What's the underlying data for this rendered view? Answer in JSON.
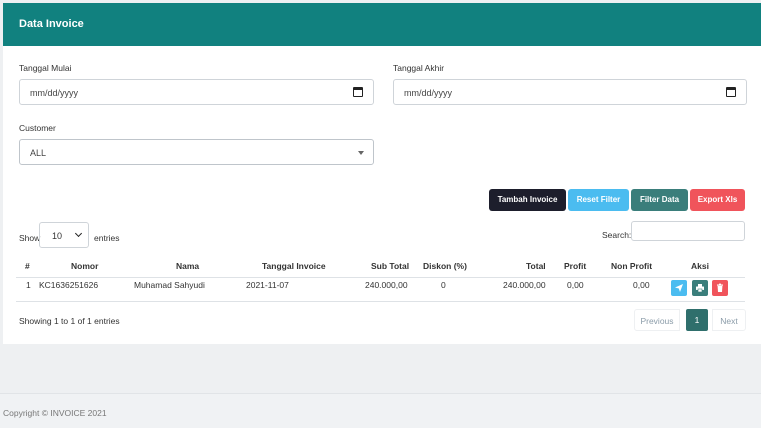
{
  "header": {
    "title": "Data Invoice"
  },
  "filters": {
    "start_label": "Tanggal Mulai",
    "start_placeholder": "mm/dd/yyyy",
    "end_label": "Tanggal Akhir",
    "end_placeholder": "mm/dd/yyyy",
    "customer_label": "Customer",
    "customer_value": "ALL"
  },
  "actions": {
    "tambah": "Tambah Invoice",
    "reset": "Reset Filter",
    "filter": "Filter Data",
    "export": "Export Xls"
  },
  "table_controls": {
    "show_label": "Show",
    "entries_value": "10",
    "entries_label": "entries",
    "search_label": "Search:"
  },
  "table": {
    "headers": [
      "#",
      "Nomor",
      "Nama",
      "Tanggal Invoice",
      "Sub Total",
      "Diskon (%)",
      "Total",
      "Profit",
      "Non Profit",
      "Aksi"
    ],
    "rows": [
      [
        "1",
        "KC1636251626",
        "Muhamad Sahyudi",
        "2021-11-07",
        "240.000,00",
        "0",
        "240.000,00",
        "0,00",
        "0,00"
      ]
    ],
    "row_actions": [
      "send-icon",
      "print-icon",
      "trash-icon"
    ]
  },
  "pagination": {
    "info": "Showing 1 to 1 of 1 entries",
    "previous": "Previous",
    "current": "1",
    "next": "Next"
  },
  "footer": {
    "copyright": "Copyright © INVOICE 2021"
  },
  "colors": {
    "primary": "#11817f",
    "dark": "#1d1e2c",
    "info": "#4bbcf0",
    "teal": "#3a7e7b",
    "danger": "#f0545b"
  }
}
